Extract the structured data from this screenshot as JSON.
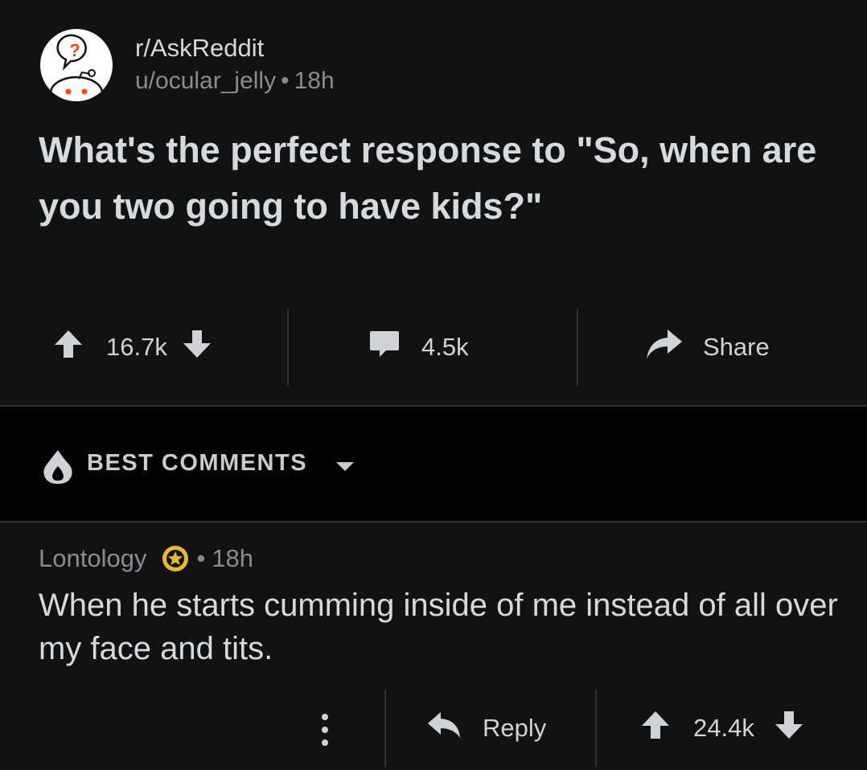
{
  "post": {
    "subreddit": "r/AskReddit",
    "author": "u/ocular_jelly",
    "separator": "•",
    "age": "18h",
    "title": "What's the perfect response to \"So, when are you two going to have kids?\"",
    "score": "16.7k",
    "comments": "4.5k",
    "share_label": "Share"
  },
  "sort": {
    "label": "BEST COMMENTS"
  },
  "comment": {
    "author": "Lontology",
    "separator": "•",
    "age": "18h",
    "body": "When he starts cumming inside of me instead of all over my face and tits.",
    "reply_label": "Reply",
    "score": "24.4k"
  },
  "colors": {
    "background": "#111213",
    "sort_bar": "#030303",
    "award": "#e8b830",
    "icon": "#d0d3d6",
    "avatar_accent": "#ff4500"
  }
}
